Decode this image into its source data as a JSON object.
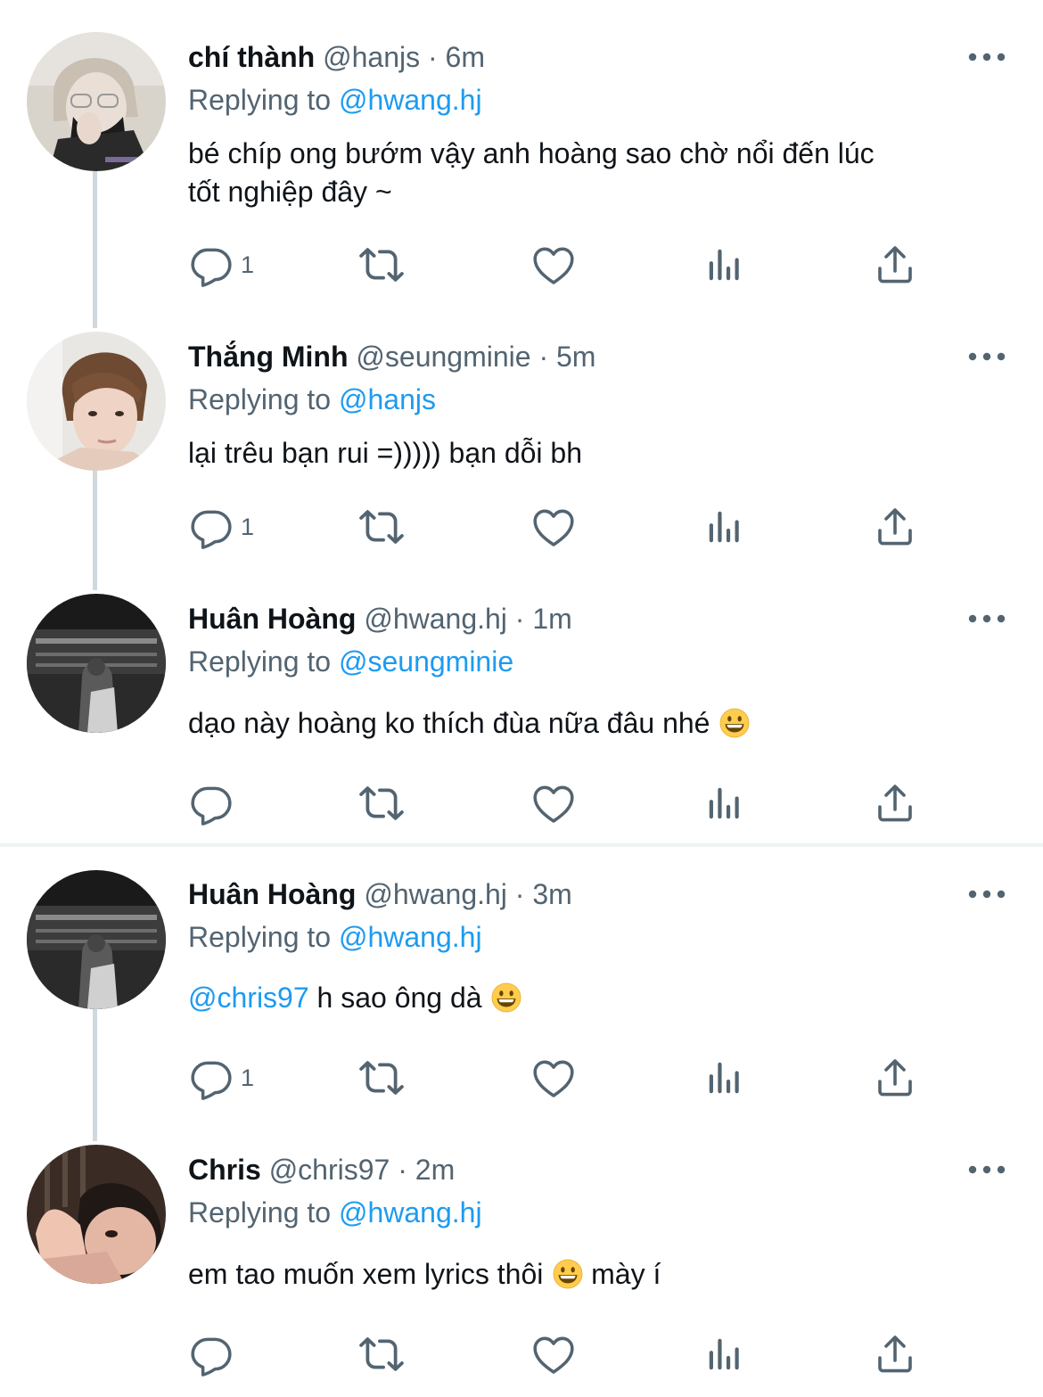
{
  "tweets": [
    {
      "name": "chí thành",
      "handle": "@hanjs",
      "separator": "·",
      "time": "6m",
      "replying_prefix": "Replying to",
      "replying_to": "@hanjs_target",
      "replying_to_text": "@hwang.hj",
      "text_line1": "bé chíp ong bướm vậy anh hoàng sao chờ nổi đến lúc",
      "text_line2": "tốt nghiệp đây ~",
      "reply_count": "1"
    },
    {
      "name": "Thắng Minh",
      "handle": "@seungminie",
      "separator": "·",
      "time": "5m",
      "replying_prefix": "Replying to",
      "replying_to_text": "@hanjs",
      "text": "lại trêu bạn rui =))))) bạn dỗi bh",
      "reply_count": "1"
    },
    {
      "name": "Huân Hoàng",
      "handle": "@hwang.hj",
      "separator": "·",
      "time": "1m",
      "replying_prefix": "Replying to",
      "replying_to_text": "@seungminie",
      "text": "dạo này hoàng ko thích đùa nữa đâu nhé",
      "reply_count": ""
    },
    {
      "name": "Huân Hoàng",
      "handle": "@hwang.hj",
      "separator": "·",
      "time": "3m",
      "replying_prefix": "Replying to",
      "replying_to_text": "@hwang.hj",
      "mention": "@chris97",
      "text": " h sao ông dà",
      "reply_count": "1"
    },
    {
      "name": "Chris",
      "handle": "@chris97",
      "separator": "·",
      "time": "2m",
      "replying_prefix": "Replying to",
      "replying_to_text": "@hwang.hj",
      "text_before": "em tao muốn xem lyrics thôi",
      "text_after": " mày í",
      "reply_count": ""
    }
  ],
  "colors": {
    "link": "#1d9bf0",
    "secondary": "#536471",
    "primary": "#0f1419",
    "thread_line": "#cfd9de",
    "separator": "#eff3f4"
  },
  "icons": [
    "reply-icon",
    "retweet-icon",
    "like-icon",
    "analytics-icon",
    "share-icon",
    "more-icon",
    "grinning-emoji"
  ]
}
